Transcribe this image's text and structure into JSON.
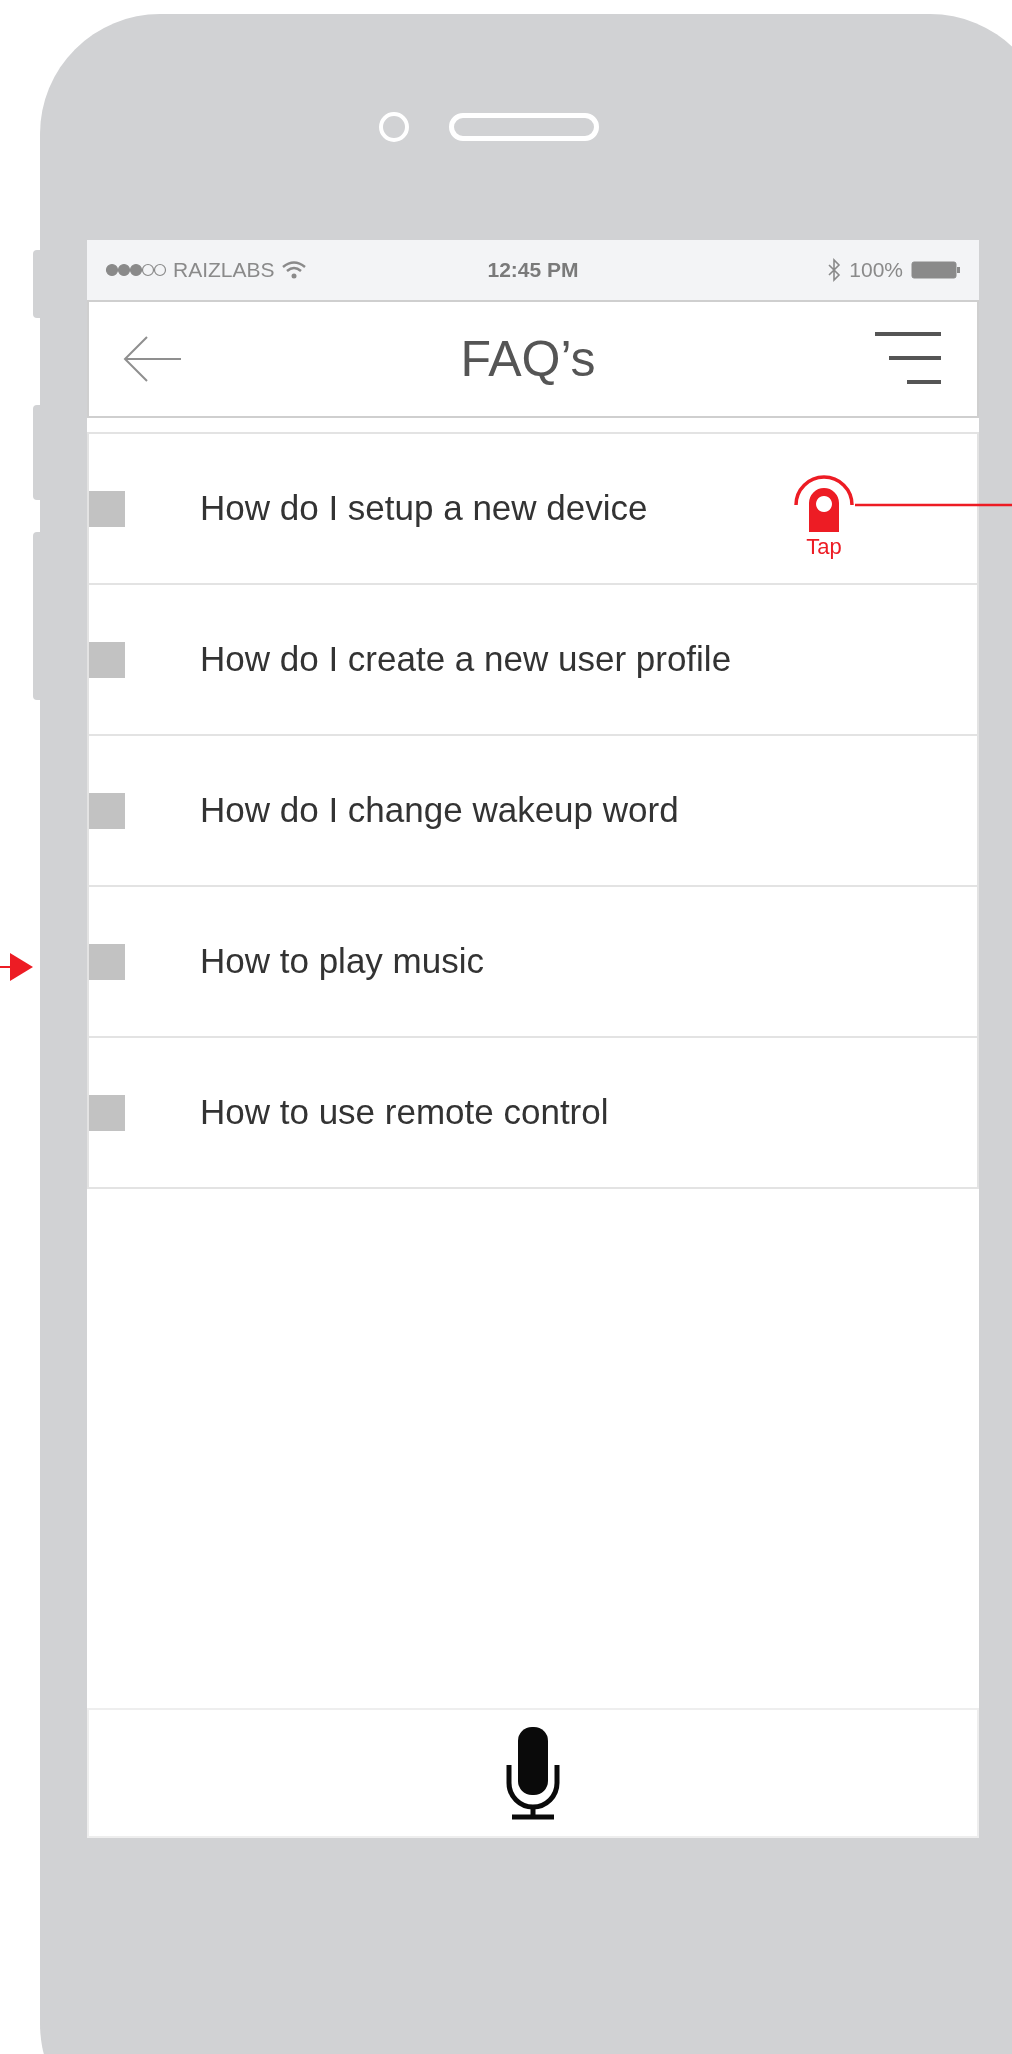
{
  "status_bar": {
    "carrier": "RAIZLABS",
    "time": "12:45 PM",
    "battery": "100%"
  },
  "header": {
    "title": "FAQ’s"
  },
  "faq_items": [
    {
      "text": "How do I setup a new device"
    },
    {
      "text": "How do I create a new user profile"
    },
    {
      "text": "How do I change wakeup word"
    },
    {
      "text": "How to play music"
    },
    {
      "text": "How to use remote control"
    }
  ],
  "annotation": {
    "label": "Tap"
  }
}
